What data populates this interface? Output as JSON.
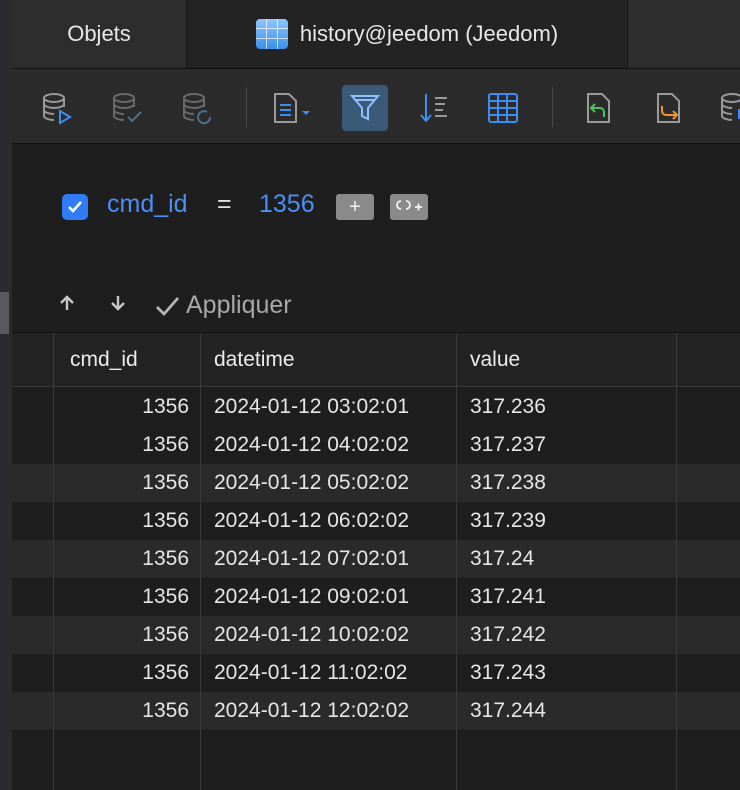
{
  "tabs": [
    {
      "label": "Objets"
    },
    {
      "label": "history@jeedom (Jeedom)"
    }
  ],
  "toolbar": {
    "icons": [
      "database-run-icon",
      "database-check-icon",
      "database-refresh-icon",
      "document-menu-icon",
      "filter-icon",
      "sort-icon",
      "table-grid-icon",
      "undo-green-icon",
      "redo-orange-icon",
      "database-partial-icon"
    ]
  },
  "filter": {
    "checked": true,
    "column": "cmd_id",
    "operator": "=",
    "value": "1356",
    "add_label": "+",
    "apply_label": "Appliquer"
  },
  "table": {
    "columns": [
      "cmd_id",
      "datetime",
      "value"
    ],
    "rows": [
      {
        "cmd_id": "1356",
        "datetime": "2024-01-12 03:02:01",
        "value": "317.236"
      },
      {
        "cmd_id": "1356",
        "datetime": "2024-01-12 04:02:02",
        "value": "317.237"
      },
      {
        "cmd_id": "1356",
        "datetime": "2024-01-12 05:02:02",
        "value": "317.238"
      },
      {
        "cmd_id": "1356",
        "datetime": "2024-01-12 06:02:02",
        "value": "317.239"
      },
      {
        "cmd_id": "1356",
        "datetime": "2024-01-12 07:02:01",
        "value": "317.24"
      },
      {
        "cmd_id": "1356",
        "datetime": "2024-01-12 09:02:01",
        "value": "317.241"
      },
      {
        "cmd_id": "1356",
        "datetime": "2024-01-12 10:02:02",
        "value": "317.242"
      },
      {
        "cmd_id": "1356",
        "datetime": "2024-01-12 11:02:02",
        "value": "317.243"
      },
      {
        "cmd_id": "1356",
        "datetime": "2024-01-12 12:02:02",
        "value": "317.244"
      }
    ]
  },
  "colors": {
    "accent": "#2f7cf6",
    "link": "#4a8ff5",
    "active_tool": "#3b5a78"
  }
}
